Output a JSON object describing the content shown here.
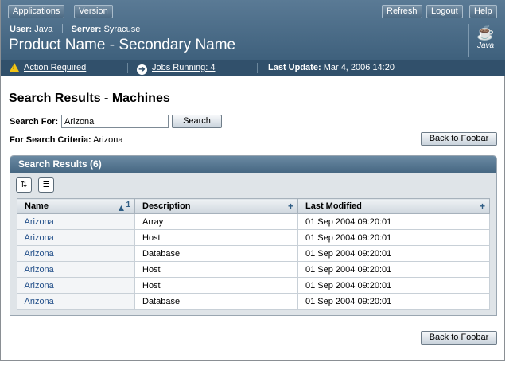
{
  "masthead": {
    "nav_buttons": [
      "Applications",
      "Version"
    ],
    "action_buttons": [
      "Refresh",
      "Logout",
      "Help"
    ],
    "user_label": "User:",
    "user_value": "Java",
    "server_label": "Server:",
    "server_value": "Syracuse",
    "product_name": "Product Name - Secondary Name",
    "logo_text": "Java"
  },
  "status": {
    "action_required": "Action Required",
    "jobs_running": "Jobs Running: 4",
    "last_update_label": "Last Update:",
    "last_update_value": "Mar 4, 2006 14:20"
  },
  "page": {
    "title": "Search Results - Machines",
    "search_label": "Search For:",
    "search_value": "Arizona",
    "search_button": "Search",
    "criteria_label": "For Search Criteria:",
    "criteria_value": "Arizona",
    "back_button": "Back to Foobar"
  },
  "table": {
    "title": "Search Results (6)",
    "sort_indicator": "1",
    "columns": [
      "Name",
      "Description",
      "Last Modified"
    ],
    "rows": [
      {
        "name": "Arizona",
        "description": "Array",
        "modified": "01 Sep 2004 09:20:01"
      },
      {
        "name": "Arizona",
        "description": "Host",
        "modified": "01 Sep 2004 09:20:01"
      },
      {
        "name": "Arizona",
        "description": "Database",
        "modified": "01 Sep 2004 09:20:01"
      },
      {
        "name": "Arizona",
        "description": "Host",
        "modified": "01 Sep 2004 09:20:01"
      },
      {
        "name": "Arizona",
        "description": "Host",
        "modified": "01 Sep 2004 09:20:01"
      },
      {
        "name": "Arizona",
        "description": "Database",
        "modified": "01 Sep 2004 09:20:01"
      }
    ]
  }
}
